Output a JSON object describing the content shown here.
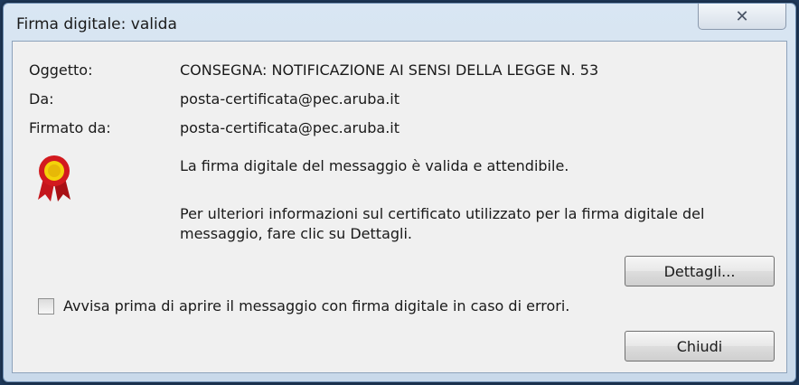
{
  "window": {
    "title": "Firma digitale: valida",
    "close_icon": "close-icon",
    "close_glyph": "✕"
  },
  "fields": {
    "subject_label": "Oggetto:",
    "subject_value": "CONSEGNA: NOTIFICAZIONE AI SENSI DELLA LEGGE N. 53",
    "from_label": "Da:",
    "from_value": "posta-certificata@pec.aruba.it",
    "signed_by_label": "Firmato da:",
    "signed_by_value": "posta-certificata@pec.aruba.it"
  },
  "status": {
    "icon": "certificate-seal-icon",
    "valid_message": "La firma digitale del messaggio è valida e attendibile.",
    "details_info": "Per ulteriori informazioni sul certificato utilizzato per la firma digitale del messaggio, fare clic su Dettagli."
  },
  "buttons": {
    "details_label": "Dettagli...",
    "close_label": "Chiudi"
  },
  "option": {
    "warn_label": "Avvisa prima di aprire il messaggio con firma digitale in caso di errori.",
    "checked": false
  }
}
